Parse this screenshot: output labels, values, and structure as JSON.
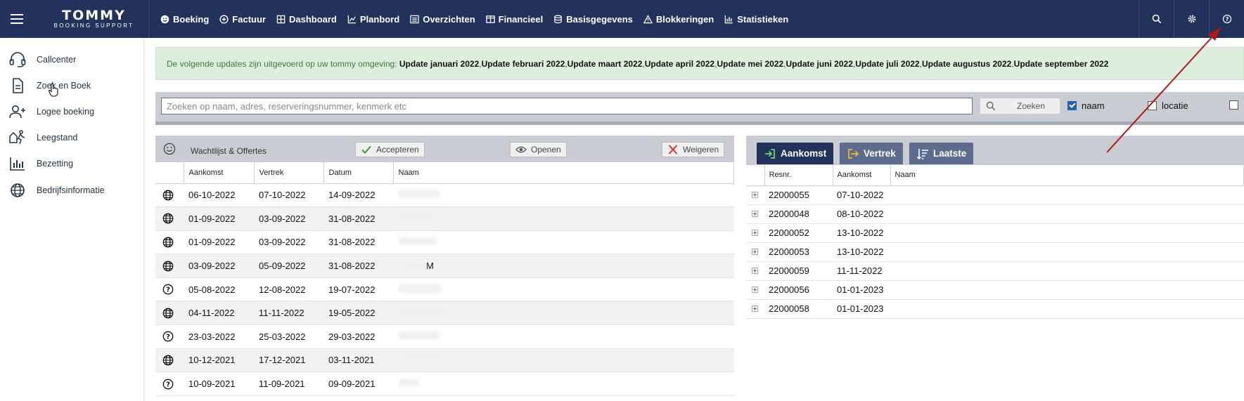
{
  "app": {
    "logo_main": "TOMMY",
    "logo_sub": "BOOKING SUPPORT"
  },
  "nav": [
    {
      "label": "Boeking",
      "icon": "smiley-icon"
    },
    {
      "label": "Factuur",
      "icon": "plus-circle-icon"
    },
    {
      "label": "Dashboard",
      "icon": "grid-icon"
    },
    {
      "label": "Planbord",
      "icon": "chart-icon"
    },
    {
      "label": "Overzichten",
      "icon": "list-icon"
    },
    {
      "label": "Financieel",
      "icon": "columns-icon"
    },
    {
      "label": "Basisgegevens",
      "icon": "database-icon"
    },
    {
      "label": "Blokkeringen",
      "icon": "warning-icon"
    },
    {
      "label": "Statistieken",
      "icon": "bar-chart-icon"
    }
  ],
  "sidebar": [
    {
      "label": "Callcenter",
      "icon": "headset-icon"
    },
    {
      "label": "Zoek en Boek",
      "icon": "document-icon"
    },
    {
      "label": "Logee boeking",
      "icon": "add-user-icon"
    },
    {
      "label": "Leegstand",
      "icon": "walking-person-icon"
    },
    {
      "label": "Bezetting",
      "icon": "bar-chart-icon"
    },
    {
      "label": "Bedrijfsinformatie",
      "icon": "globe-icon"
    }
  ],
  "notice": {
    "intro": "De volgende updates zijn uitgevoerd op uw tommy omgeving:",
    "updates": [
      "Update januari 2022",
      "Update februari 2022",
      "Update maart 2022",
      "Update april 2022",
      "Update mei 2022",
      "Update juni 2022",
      "Update juli 2022",
      "Update augustus 2022",
      "Update september 2022"
    ]
  },
  "search": {
    "placeholder": "Zoeken op naam, adres, reserveringsnummer, kenmerk etc",
    "button": "Zoeken",
    "filters": [
      {
        "label": "naam",
        "checked": true
      },
      {
        "label": "locatie",
        "checked": false
      }
    ]
  },
  "wachtlijst": {
    "title": "Wachtlijst & Offertes",
    "buttons": {
      "accept": "Accepteren",
      "open": "Openen",
      "reject": "Weigeren"
    },
    "columns": [
      "Aankomst",
      "Vertrek",
      "Datum",
      "Naam"
    ],
    "rows": [
      {
        "icon": "globe-icon",
        "aankomst": "06-10-2022",
        "vertrek": "07-10-2022",
        "datum": "14-09-2022",
        "naam": ""
      },
      {
        "icon": "globe-icon",
        "aankomst": "01-09-2022",
        "vertrek": "03-09-2022",
        "datum": "31-08-2022",
        "naam": ""
      },
      {
        "icon": "globe-icon",
        "aankomst": "01-09-2022",
        "vertrek": "03-09-2022",
        "datum": "31-08-2022",
        "naam": ""
      },
      {
        "icon": "globe-icon",
        "aankomst": "03-09-2022",
        "vertrek": "05-09-2022",
        "datum": "31-08-2022",
        "naam": "M"
      },
      {
        "icon": "question-icon",
        "aankomst": "05-08-2022",
        "vertrek": "12-08-2022",
        "datum": "19-07-2022",
        "naam": ""
      },
      {
        "icon": "globe-icon",
        "aankomst": "04-11-2022",
        "vertrek": "11-11-2022",
        "datum": "19-05-2022",
        "naam": ""
      },
      {
        "icon": "question-icon",
        "aankomst": "23-03-2022",
        "vertrek": "25-03-2022",
        "datum": "29-03-2022",
        "naam": ""
      },
      {
        "icon": "globe-icon",
        "aankomst": "10-12-2021",
        "vertrek": "17-12-2021",
        "datum": "03-11-2021",
        "naam": ""
      },
      {
        "icon": "question-icon",
        "aankomst": "10-09-2021",
        "vertrek": "11-09-2021",
        "datum": "09-09-2021",
        "naam": ""
      }
    ]
  },
  "arrivals": {
    "tabs": [
      {
        "label": "Aankomst",
        "active": true
      },
      {
        "label": "Vertrek",
        "active": false
      },
      {
        "label": "Laatste",
        "active": false
      }
    ],
    "columns": [
      "Resnr.",
      "Aankomst",
      "Naam"
    ],
    "rows": [
      {
        "resnr": "22000055",
        "aankomst": "07-10-2022",
        "naam": ""
      },
      {
        "resnr": "22000048",
        "aankomst": "08-10-2022",
        "naam": ""
      },
      {
        "resnr": "22000052",
        "aankomst": "13-10-2022",
        "naam": ""
      },
      {
        "resnr": "22000053",
        "aankomst": "13-10-2022",
        "naam": ""
      },
      {
        "resnr": "22000059",
        "aankomst": "11-11-2022",
        "naam": ""
      },
      {
        "resnr": "22000056",
        "aankomst": "01-01-2023",
        "naam": ""
      },
      {
        "resnr": "22000058",
        "aankomst": "01-01-2023",
        "naam": ""
      }
    ]
  },
  "colors": {
    "topbar": "#23325a",
    "notice_bg": "#ddeedd",
    "notice_text": "#3c7a3c",
    "annotation_arrow": "#b01818"
  }
}
